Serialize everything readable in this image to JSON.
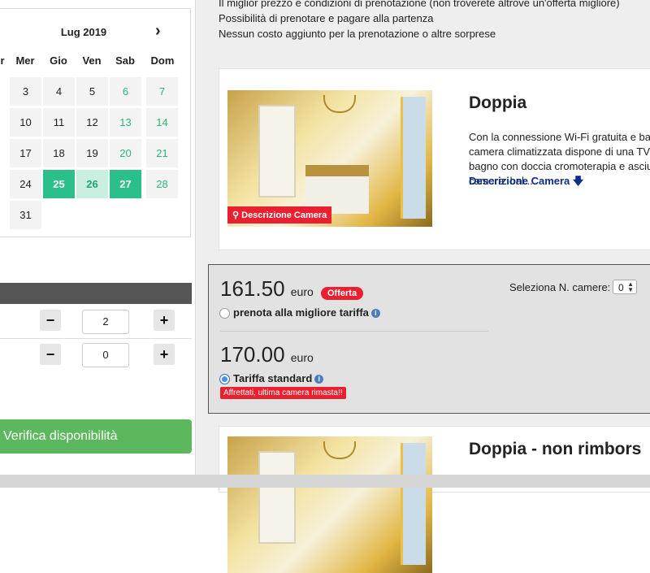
{
  "calendar": {
    "month_label": "Lug 2019",
    "next_label": "›",
    "weekdays": [
      "r",
      "Mer",
      "Gio",
      "Ven",
      "Sab",
      "Dom"
    ],
    "rows": [
      [
        "",
        "3",
        "4",
        "5",
        "6",
        "7"
      ],
      [
        "",
        "10",
        "11",
        "12",
        "13",
        "14"
      ],
      [
        "",
        "17",
        "18",
        "19",
        "20",
        "21"
      ],
      [
        "",
        "24",
        "25",
        "26",
        "27",
        "28"
      ],
      [
        "",
        "31"
      ]
    ],
    "selected_start": "25",
    "selected_end": "27",
    "in_range": "26"
  },
  "guests": {
    "adults_minus": "−",
    "adults_value": "2",
    "adults_plus": "+",
    "children_minus": "−",
    "children_value": "0",
    "children_plus": "+"
  },
  "verify_button": "Verifica disponibilità",
  "info_lines": [
    "Il miglior prezzo e condizioni di prenotazione (non troverete altrove un'offerta migliore)",
    "Possibilità di prenotare e pagare alla partenza",
    "Nessun costo aggiunto per la prenotazione o altre sorprese"
  ],
  "room1": {
    "title": "Doppia",
    "image_button": "Descrizione Camera",
    "desc_lines": [
      "Con la connessione Wi-Fi gratuita e bal",
      "camera climatizzata dispone di una TV",
      "bagno con doccia cromoterapia e asciu",
      "camera: bal ..."
    ],
    "desc_link": "Descrizione Camera"
  },
  "rates": {
    "offer_price": "161.50",
    "offer_unit": "euro",
    "offer_badge": "Offerta",
    "offer_label": "prenota alla migliore tariffa",
    "std_price": "170.00",
    "std_unit": "euro",
    "std_label": "Tariffa standard",
    "alert": "Affrettati, ultima camera rimasta!!",
    "rooms_select_label": "Seleziona N. camere:",
    "rooms_select_value": "0",
    "selected_rate": "standard"
  },
  "room2": {
    "title": "Doppia - non rimbors"
  },
  "colors": {
    "accent_green": "#2bbf8a",
    "verify_green": "#5cb85c",
    "badge_red": "#e8202f",
    "link_blue": "#0a2e8a"
  }
}
